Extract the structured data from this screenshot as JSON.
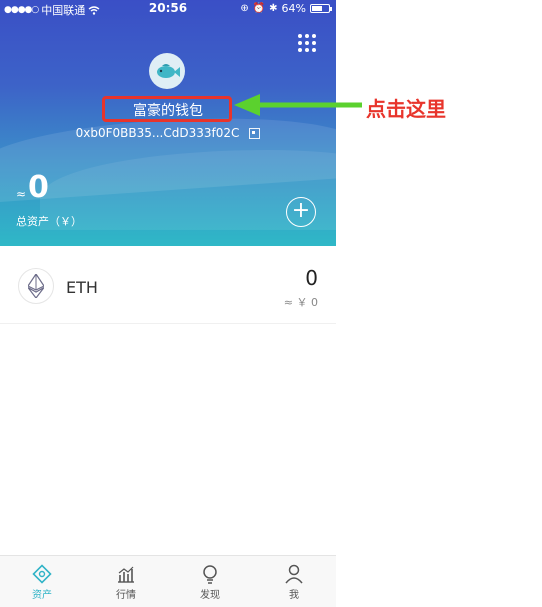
{
  "status_bar": {
    "carrier": "中国联通",
    "time": "20:56",
    "battery": "64%",
    "battery_level": 0.64
  },
  "wallet": {
    "name": "富豪的钱包",
    "address": "0xb0F0BB35...CdD333f02C",
    "approx_symbol": "≈",
    "total_value": "0",
    "total_label": "总资产（￥）"
  },
  "assets": [
    {
      "symbol": "ETH",
      "amount": "0",
      "fiat": "≈ ￥ 0"
    }
  ],
  "tabs": [
    {
      "label": "资产",
      "icon": "assets-icon",
      "active": true
    },
    {
      "label": "行情",
      "icon": "market-icon",
      "active": false
    },
    {
      "label": "发现",
      "icon": "discover-icon",
      "active": false
    },
    {
      "label": "我",
      "icon": "profile-icon",
      "active": false
    }
  ],
  "annotation": {
    "text": "点击这里",
    "color": "#e8342b",
    "arrow_color": "#5bd12e"
  },
  "colors": {
    "header_top": "#3a4fc6",
    "header_bottom": "#2fb8c7",
    "accent": "#2fb3c7"
  }
}
